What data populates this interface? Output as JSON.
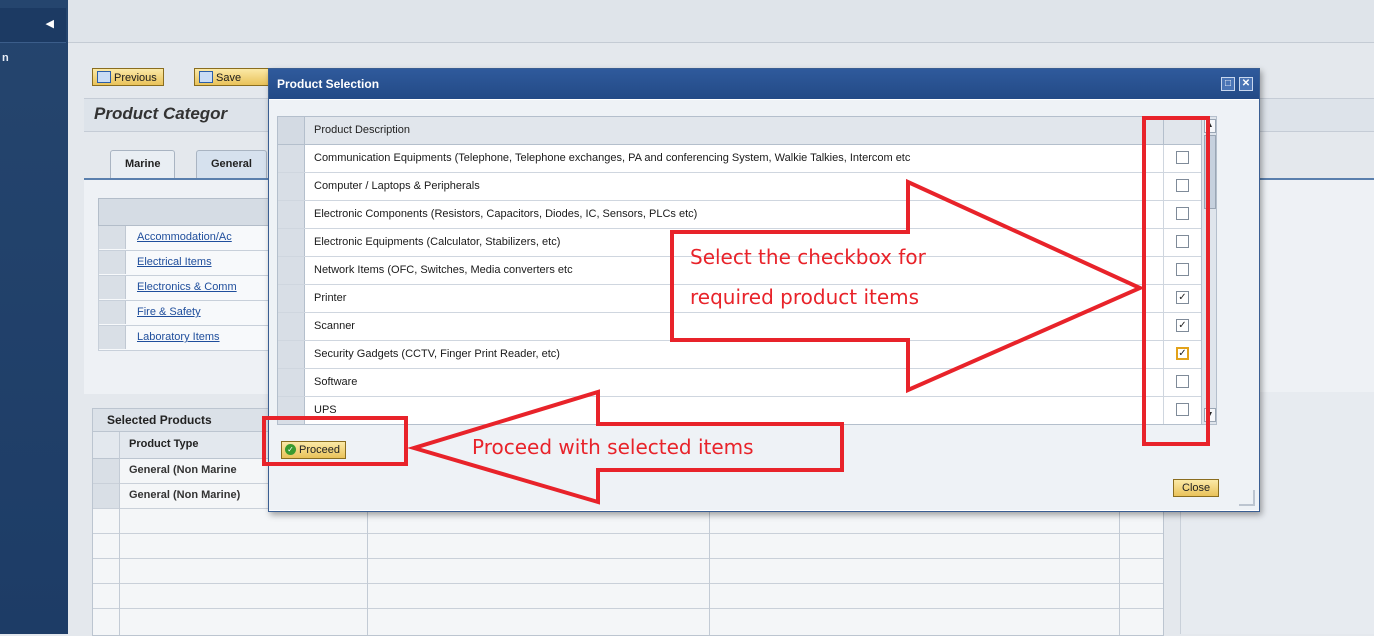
{
  "nav": {
    "fragment": "n"
  },
  "toolbar": {
    "previous_label": "Previous",
    "save_label": "Save"
  },
  "page": {
    "title": "Product Categor"
  },
  "tabs": [
    {
      "label": "Marine"
    },
    {
      "label": "General"
    }
  ],
  "categories": [
    {
      "label": "Accommodation/Ac"
    },
    {
      "label": "Electrical Items"
    },
    {
      "label": "Electronics & Comm"
    },
    {
      "label": "Fire & Safety"
    },
    {
      "label": "Laboratory Items"
    }
  ],
  "selected_products": {
    "title": "Selected Products",
    "column_header": "Product Type",
    "rows": [
      {
        "type": "General (Non Marine"
      },
      {
        "type": "General (Non Marine)"
      }
    ]
  },
  "dialog": {
    "title": "Product Selection",
    "column_header": "Product Description",
    "items": [
      {
        "desc": "Communication Equipments (Telephone, Telephone exchanges, PA and conferencing System, Walkie Talkies, Intercom etc",
        "checked": false
      },
      {
        "desc": "Computer / Laptops & Peripherals",
        "checked": false
      },
      {
        "desc": "Electronic Components (Resistors, Capacitors, Diodes, IC, Sensors, PLCs etc)",
        "checked": false
      },
      {
        "desc": "Electronic Equipments (Calculator, Stabilizers, etc)",
        "checked": false
      },
      {
        "desc": "Network Items (OFC, Switches, Media converters etc",
        "checked": false
      },
      {
        "desc": "Printer",
        "checked": true
      },
      {
        "desc": "Scanner",
        "checked": true
      },
      {
        "desc": "Security Gadgets (CCTV, Finger Print Reader, etc)",
        "checked": true
      },
      {
        "desc": "Software",
        "checked": false
      },
      {
        "desc": "UPS",
        "checked": false
      }
    ],
    "proceed_label": "Proceed",
    "close_label": "Close"
  },
  "annotations": {
    "checkbox_hint_line1": "Select the checkbox for",
    "checkbox_hint_line2": "required product items",
    "proceed_hint": "Proceed with selected items"
  },
  "colors": {
    "annotation": "#e8232a",
    "titlebar": "#2f5a9c",
    "button": "#e9c25a"
  }
}
